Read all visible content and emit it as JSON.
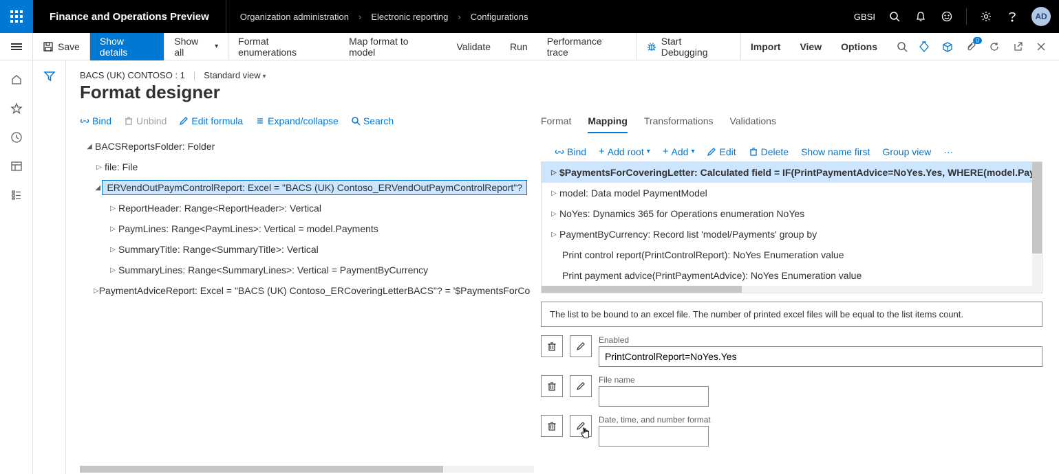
{
  "header": {
    "app_title": "Finance and Operations Preview",
    "breadcrumb": [
      "Organization administration",
      "Electronic reporting",
      "Configurations"
    ],
    "company": "GBSI",
    "avatar": "AD"
  },
  "cmdbar": {
    "save": "Save",
    "show_details": "Show details",
    "show_all": "Show all",
    "format_enum": "Format enumerations",
    "map_format": "Map format to model",
    "validate": "Validate",
    "run": "Run",
    "perf_trace": "Performance trace",
    "start_debug": "Start Debugging",
    "import": "Import",
    "view": "View",
    "options": "Options",
    "badge": "0"
  },
  "context": {
    "config": "BACS (UK) CONTOSO : 1",
    "view": "Standard view"
  },
  "page_title": "Format designer",
  "left_toolbar": {
    "bind": "Bind",
    "unbind": "Unbind",
    "edit_formula": "Edit formula",
    "expand": "Expand/collapse",
    "search": "Search"
  },
  "right_tabs": {
    "format": "Format",
    "mapping": "Mapping",
    "transformations": "Transformations",
    "validations": "Validations"
  },
  "right_toolbar": {
    "bind": "Bind",
    "add_root": "Add root",
    "add": "Add",
    "edit": "Edit",
    "delete": "Delete",
    "show_name_first": "Show name first",
    "group_view": "Group view"
  },
  "tree": {
    "root": "BACSReportsFolder: Folder",
    "file": "file: File",
    "selected": "ERVendOutPaymControlReport: Excel = \"BACS (UK) Contoso_ERVendOutPaymControlReport\"?",
    "report_header": "ReportHeader: Range<ReportHeader>: Vertical",
    "paym_lines": "PaymLines: Range<PaymLines>: Vertical = model.Payments",
    "summary_title": "SummaryTitle: Range<SummaryTitle>: Vertical",
    "summary_lines": "SummaryLines: Range<SummaryLines>: Vertical = PaymentByCurrency",
    "payment_advice": "PaymentAdviceReport: Excel = \"BACS (UK) Contoso_ERCoveringLetterBACS\"? = '$PaymentsForCo"
  },
  "mapping": {
    "n1": "$PaymentsForCoveringLetter: Calculated field = IF(PrintPaymentAdvice=NoYes.Yes, WHERE(model.Payn",
    "n2": "model: Data model PaymentModel",
    "n3": "NoYes: Dynamics 365 for Operations enumeration NoYes",
    "n4": "PaymentByCurrency: Record list 'model/Payments' group by",
    "n5": "Print control report(PrintControlReport): NoYes Enumeration value",
    "n6": "Print payment advice(PrintPaymentAdvice): NoYes Enumeration value"
  },
  "infobox": "The list to be bound to an excel file. The number of printed excel files will be equal to the list items count.",
  "props": {
    "enabled_label": "Enabled",
    "enabled_value": "PrintControlReport=NoYes.Yes",
    "filename_label": "File name",
    "filename_value": "",
    "dtformat_label": "Date, time, and number format",
    "dtformat_value": ""
  }
}
